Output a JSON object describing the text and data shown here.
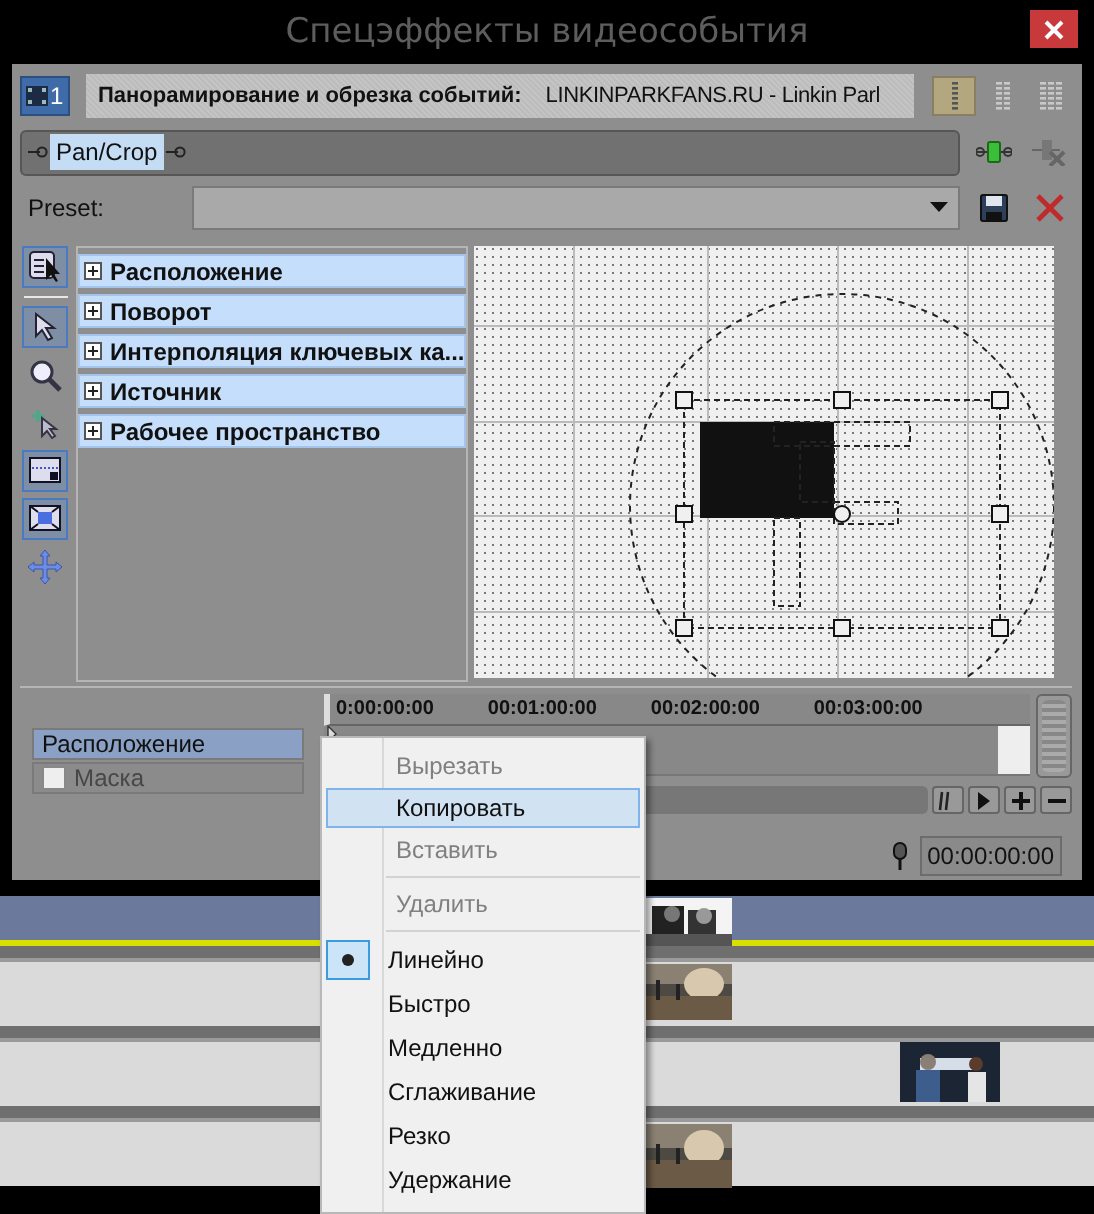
{
  "window": {
    "title": "Спецэффекты видеособытия"
  },
  "header": {
    "track_number": "1",
    "label": "Панорамирование и обрезка событий:",
    "event": "LINKINPARKFANS.RU - Linkin Parl",
    "views": [
      {
        "kind": "single",
        "selected": true
      },
      {
        "kind": "double",
        "selected": false
      },
      {
        "kind": "triple",
        "selected": false
      }
    ]
  },
  "fx_chain": {
    "plugins": [
      {
        "label": "Pan/Crop",
        "selected": true
      }
    ]
  },
  "preset": {
    "label": "Preset:"
  },
  "tools": [
    {
      "kind": "properties",
      "selected": true
    },
    {
      "kind": "separator"
    },
    {
      "kind": "pointer",
      "selected": true
    },
    {
      "kind": "zoom",
      "selected": false
    },
    {
      "kind": "pointer-plus",
      "selected": false
    },
    {
      "kind": "frame",
      "selected": true
    },
    {
      "kind": "frame-fit",
      "selected": true
    },
    {
      "kind": "move",
      "selected": false
    }
  ],
  "properties": [
    {
      "label": "Расположение",
      "expanded": false
    },
    {
      "label": "Поворот",
      "expanded": false
    },
    {
      "label": "Интерполяция ключевых ка...",
      "expanded": false
    },
    {
      "label": "Источник",
      "expanded": false
    },
    {
      "label": "Рабочее пространство",
      "expanded": false
    }
  ],
  "keyframe_tracks": [
    {
      "kind": "row",
      "label": "Расположение",
      "selected": true
    },
    {
      "kind": "checkbox",
      "label": "Маска",
      "checked": false,
      "disabled": true
    }
  ],
  "ruler": [
    "0:00:00:00",
    "00:01:00:00",
    "00:02:00:00",
    "00:03:00:00"
  ],
  "time": "00:00:00:00",
  "timeline": [
    {
      "selected": true
    },
    {
      "selected": false
    },
    {
      "selected": false
    },
    {
      "selected": false
    }
  ],
  "menu": {
    "groups": [
      {
        "kind": "commands",
        "items": [
          {
            "label": "Вырезать",
            "disabled": true,
            "highlighted": false
          },
          {
            "label": "Копировать",
            "disabled": false,
            "highlighted": true
          },
          {
            "label": "Вставить",
            "disabled": true,
            "highlighted": false
          }
        ]
      },
      {
        "kind": "commands",
        "items": [
          {
            "label": "Удалить",
            "disabled": true,
            "highlighted": false
          }
        ]
      },
      {
        "kind": "options",
        "items": [
          {
            "label": "Линейно",
            "selected": true
          },
          {
            "label": "Быстро",
            "selected": false
          },
          {
            "label": "Медленно",
            "selected": false
          },
          {
            "label": "Сглаживание",
            "selected": false
          },
          {
            "label": "Резко",
            "selected": false
          },
          {
            "label": "Удержание",
            "selected": false
          }
        ]
      }
    ]
  }
}
